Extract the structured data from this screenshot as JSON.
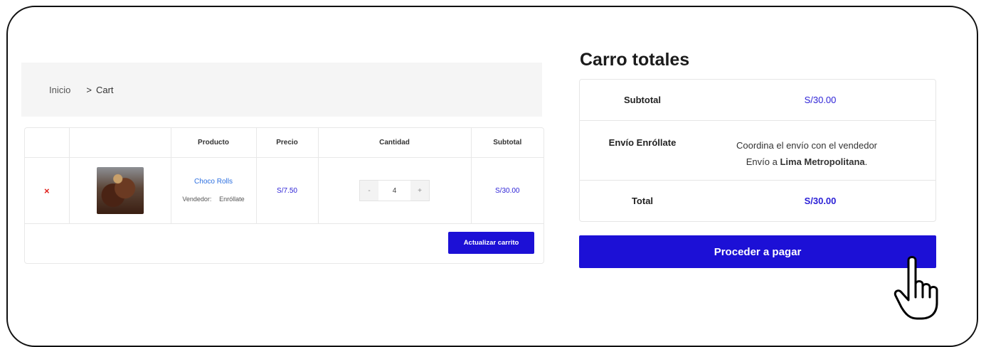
{
  "breadcrumb": {
    "home": "Inicio",
    "separator": ">",
    "current": "Cart"
  },
  "cart": {
    "headers": {
      "product": "Producto",
      "price": "Precio",
      "quantity": "Cantidad",
      "subtotal": "Subtotal"
    },
    "items": [
      {
        "remove": "×",
        "name": "Choco Rolls",
        "vendor_label": "Vendedor:",
        "vendor": "Enróllate",
        "price": "S/7.50",
        "qty_minus": "-",
        "qty": "4",
        "qty_plus": "+",
        "subtotal": "S/30.00"
      }
    ],
    "update_button": "Actualizar carrito"
  },
  "totals": {
    "title": "Carro totales",
    "subtotal_label": "Subtotal",
    "subtotal_value": "S/30.00",
    "shipping_label": "Envío Enróllate",
    "shipping_line1": "Coordina el envío con el vendedor",
    "shipping_line2_prefix": "Envío a",
    "shipping_location": "Lima Metropolitana",
    "shipping_line2_suffix": ".",
    "total_label": "Total",
    "total_value": "S/30.00",
    "checkout_button": "Proceder a pagar"
  },
  "colors": {
    "accent": "#1c10d6",
    "link": "#2c6fe0",
    "remove": "#e0201b"
  }
}
